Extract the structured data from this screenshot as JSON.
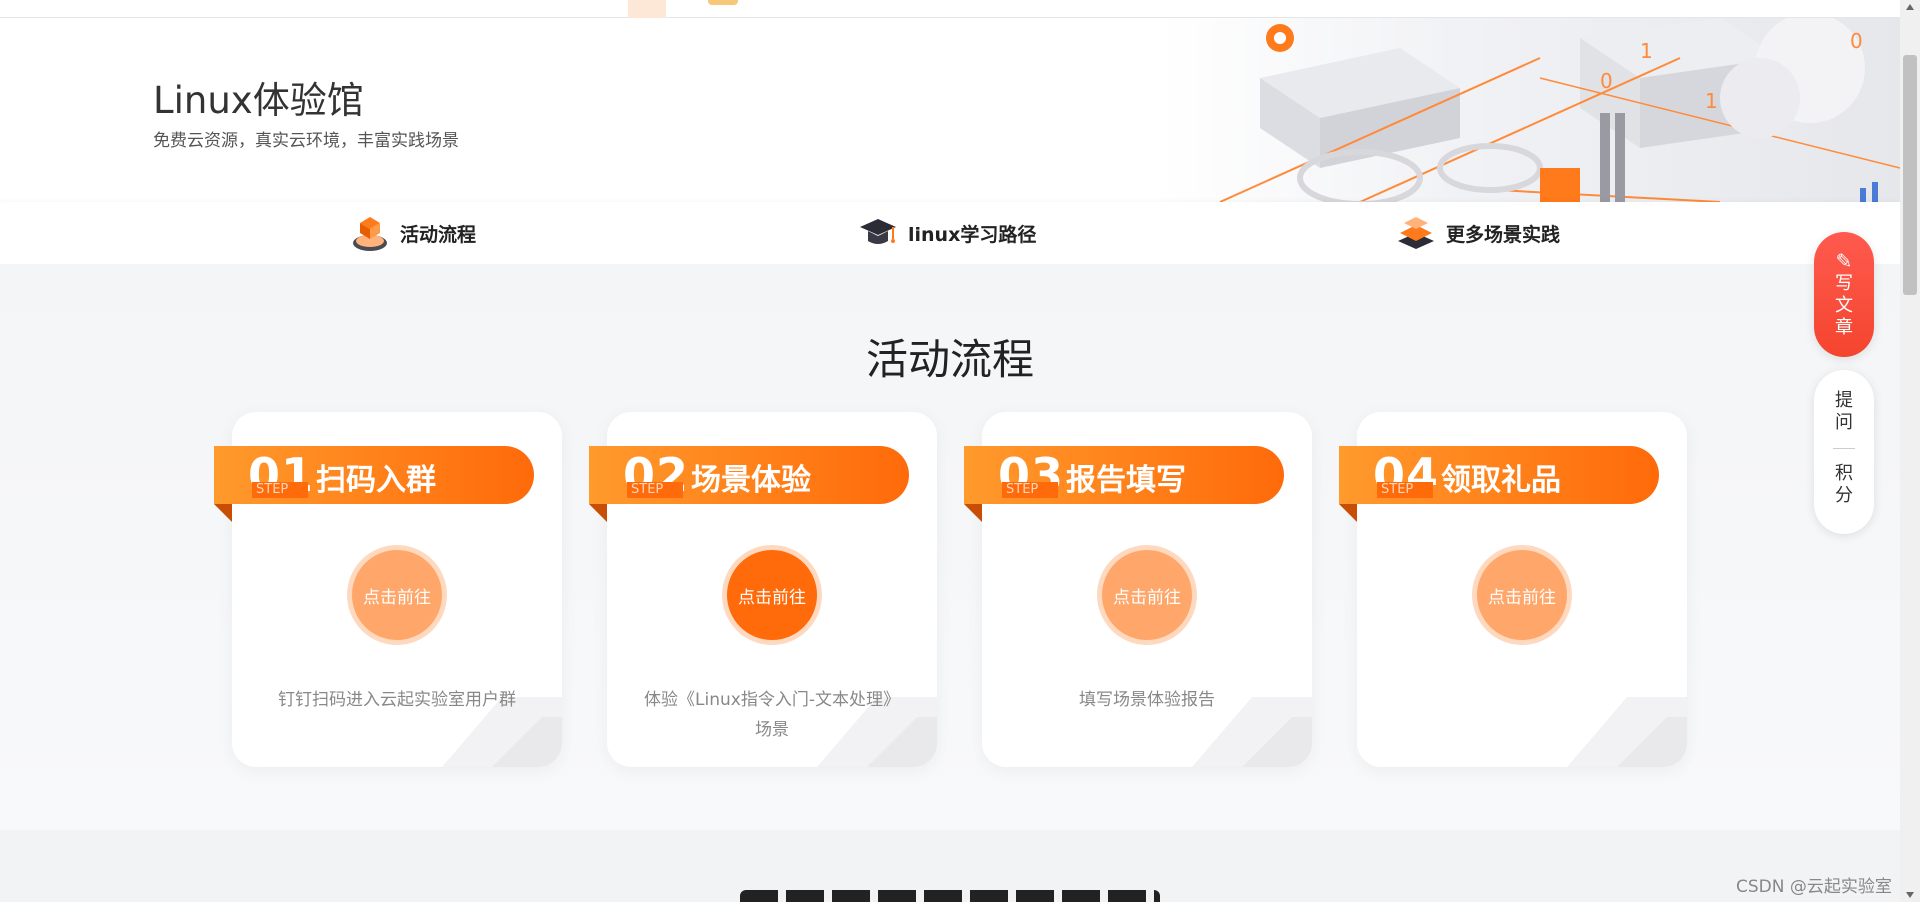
{
  "hero": {
    "title": "Linux体验馆",
    "subtitle": "免费云资源，真实云环境，丰富实践场景"
  },
  "tabs": [
    {
      "label": "活动流程",
      "icon": "orange-cube-icon"
    },
    {
      "label": "linux学习路径",
      "icon": "graduation-cap-icon"
    },
    {
      "label": "更多场景实践",
      "icon": "layers-icon"
    }
  ],
  "section": {
    "title": "活动流程"
  },
  "steps": [
    {
      "num": "01",
      "step": "STEP",
      "label": "扫码入群",
      "button": "点击前往",
      "desc": "钉钉扫码进入云起实验室用户群",
      "active": false
    },
    {
      "num": "02",
      "step": "STEP",
      "label": "场景体验",
      "button": "点击前往",
      "desc": "体验《Linux指令入门-文本处理》场景",
      "active": true
    },
    {
      "num": "03",
      "step": "STEP",
      "label": "报告填写",
      "button": "点击前往",
      "desc": "填写场景体验报告",
      "active": false
    },
    {
      "num": "04",
      "step": "STEP",
      "label": "领取礼品",
      "button": "点击前往",
      "desc": "",
      "active": false
    }
  ],
  "float": {
    "write_label": "写文章",
    "ask_label": "提问",
    "points_label": "积分"
  },
  "watermark": "CSDN @云起实验室",
  "colors": {
    "accent": "#ff6a0a",
    "accent_light": "#ffa76a",
    "write": "#f4452e"
  }
}
